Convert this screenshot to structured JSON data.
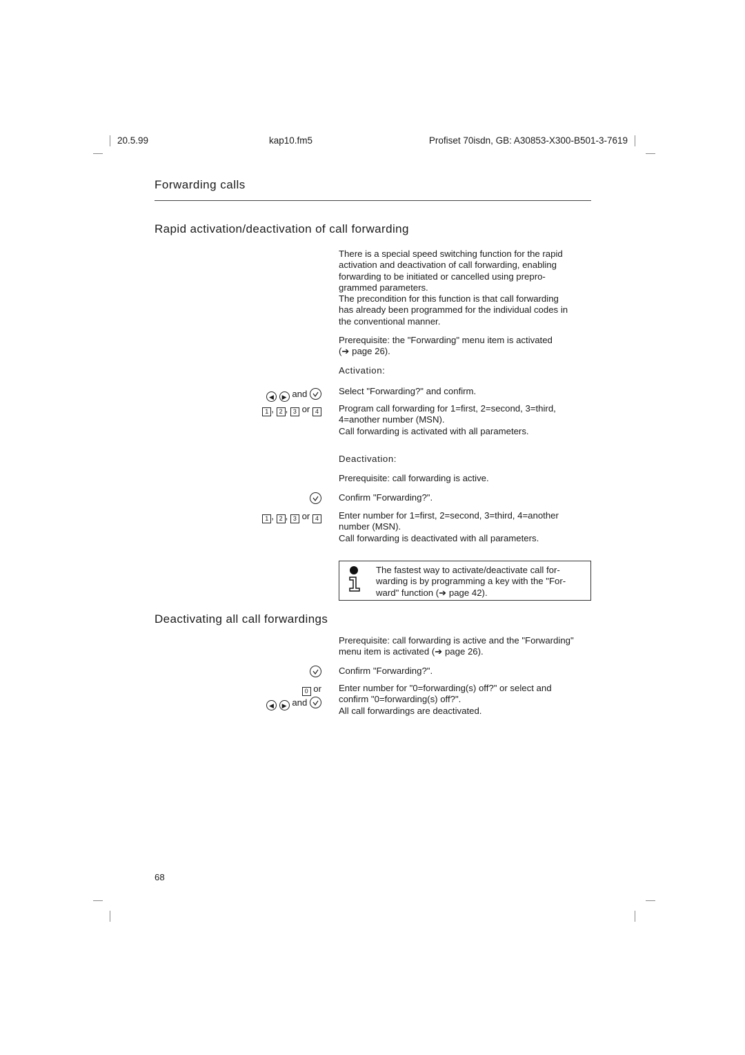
{
  "header": {
    "date": "20.5.99",
    "file": "kap10.fm5",
    "product": "Profiset 70isdn, GB: A30853-X300-B501-3-7619"
  },
  "chapter_title": "Forwarding calls",
  "section1": {
    "title": "Rapid activation/deactivation of call forwarding",
    "intro_lines": [
      "There is a special speed switching function for the rapid",
      "activation and deactivation of call forwarding, enabling",
      "forwarding to be initiated or cancelled using prepro-",
      "grammed parameters.",
      "The precondition for this function is that call forwarding",
      "has already been programmed for the individual codes in",
      "the conventional manner."
    ],
    "prereq_lines": [
      "Prerequisite: the \"Forwarding\" menu item is activated",
      "(➔ page 26)."
    ],
    "activation": {
      "label": "Activation:",
      "steps": [
        {
          "keys_text": "and",
          "keys_icons": [
            "left-arrow-key",
            "right-arrow-key",
            "confirm-key"
          ],
          "lines": [
            "Select \"Forwarding?\" and confirm."
          ]
        },
        {
          "keys_digits": [
            "1",
            "2",
            "3",
            "4"
          ],
          "keys_or": "or",
          "lines": [
            "Program call forwarding for 1=first, 2=second, 3=third,",
            "4=another number (MSN).",
            "Call forwarding is activated with all parameters."
          ]
        }
      ]
    },
    "deactivation": {
      "label": "Deactivation:",
      "prereq": "Prerequisite: call forwarding is active.",
      "steps": [
        {
          "keys_icons": [
            "confirm-key"
          ],
          "lines": [
            "Confirm \"Forwarding?\"."
          ]
        },
        {
          "keys_digits": [
            "1",
            "2",
            "3",
            "4"
          ],
          "keys_or": "or",
          "lines": [
            "Enter number for 1=first, 2=second, 3=third, 4=another",
            "number (MSN).",
            "Call forwarding is deactivated with all parameters."
          ]
        }
      ]
    },
    "note": {
      "icon": "info-icon",
      "lines": [
        "The fastest way to activate/deactivate call for-",
        "warding is by programming a key with the \"For-",
        "ward\" function (➔ page 42)."
      ]
    }
  },
  "section2": {
    "title": "Deactivating all call forwardings",
    "prereq_lines": [
      "Prerequisite: call forwarding is active and the \"Forwarding\"",
      "menu item is activated (➔ page 26)."
    ],
    "steps": [
      {
        "keys_icons": [
          "confirm-key"
        ],
        "lines": [
          "Confirm \"Forwarding?\"."
        ]
      },
      {
        "keys_digit": "0",
        "keys_or": "or",
        "keys_text": "and",
        "lines": [
          "Enter number for \"0=forwarding(s) off?\" or select and",
          "confirm \"0=forwarding(s) off?\".",
          "All call forwardings are deactivated."
        ]
      }
    ]
  },
  "footer": {
    "page_number": "68"
  }
}
